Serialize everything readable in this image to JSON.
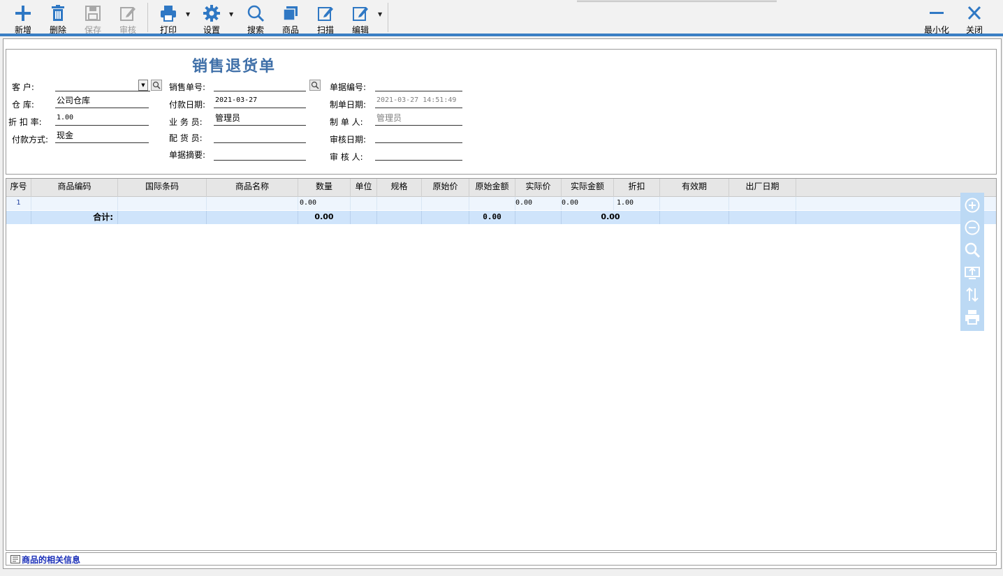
{
  "toolbar": {
    "add": "新增",
    "delete": "删除",
    "save": "保存",
    "audit": "审核",
    "print": "打印",
    "settings": "设置",
    "search": "搜索",
    "goods": "商品",
    "scan": "扫描",
    "edit": "编辑",
    "minimize": "最小化",
    "close": "关闭"
  },
  "colors": {
    "accent": "#3a7fc4",
    "title": "#3f6fa8",
    "selected_row": "#cfe4fb",
    "side_strip": "#bcd9f4",
    "info_text": "#1a2fb8"
  },
  "form": {
    "title": "销售退货单",
    "customer_label": "客    户:",
    "customer_value": "",
    "warehouse_label": "仓    库:",
    "warehouse_value": "公司仓库",
    "discount_label": "折 扣 率:",
    "discount_value": "1.00",
    "payment_method_label": "付款方式:",
    "payment_method_value": "现金",
    "sales_no_label": "销售单号:",
    "sales_no_value": "",
    "pay_date_label": "付款日期:",
    "pay_date_value": "2021-03-27",
    "salesman_label": "业 务 员:",
    "salesman_value": "管理员",
    "distributor_label": "配 货 员:",
    "distributor_value": "",
    "summary_label": "单据摘要:",
    "summary_value": "",
    "doc_no_label": "单据编号:",
    "doc_no_value": "",
    "create_date_label": "制单日期:",
    "create_date_value": "2021-03-27 14:51:49",
    "creator_label": "制 单 人:",
    "creator_value": "管理员",
    "audit_date_label": "审核日期:",
    "audit_date_value": "",
    "auditor_label": "审 核 人:",
    "auditor_value": ""
  },
  "grid": {
    "columns": [
      "序号",
      "商品编码",
      "国际条码",
      "商品名称",
      "数量",
      "单位",
      "规格",
      "原始价",
      "原始金额",
      "实际价",
      "实际金额",
      "折扣",
      "有效期",
      "出厂日期"
    ],
    "rows": [
      {
        "seq": "1",
        "qty": "0.00",
        "actual_price": "0.00",
        "actual_amount": "0.00",
        "discount": "1.00"
      }
    ],
    "total": {
      "label": "合计:",
      "qty": "0.00",
      "orig_amount": "0.00",
      "actual_amount": "0.00"
    }
  },
  "side_tools": [
    "zoom-in-icon",
    "zoom-out-icon",
    "search-icon",
    "export-icon",
    "sort-icon",
    "print-icon"
  ],
  "footer": {
    "info": "商品的相关信息"
  }
}
